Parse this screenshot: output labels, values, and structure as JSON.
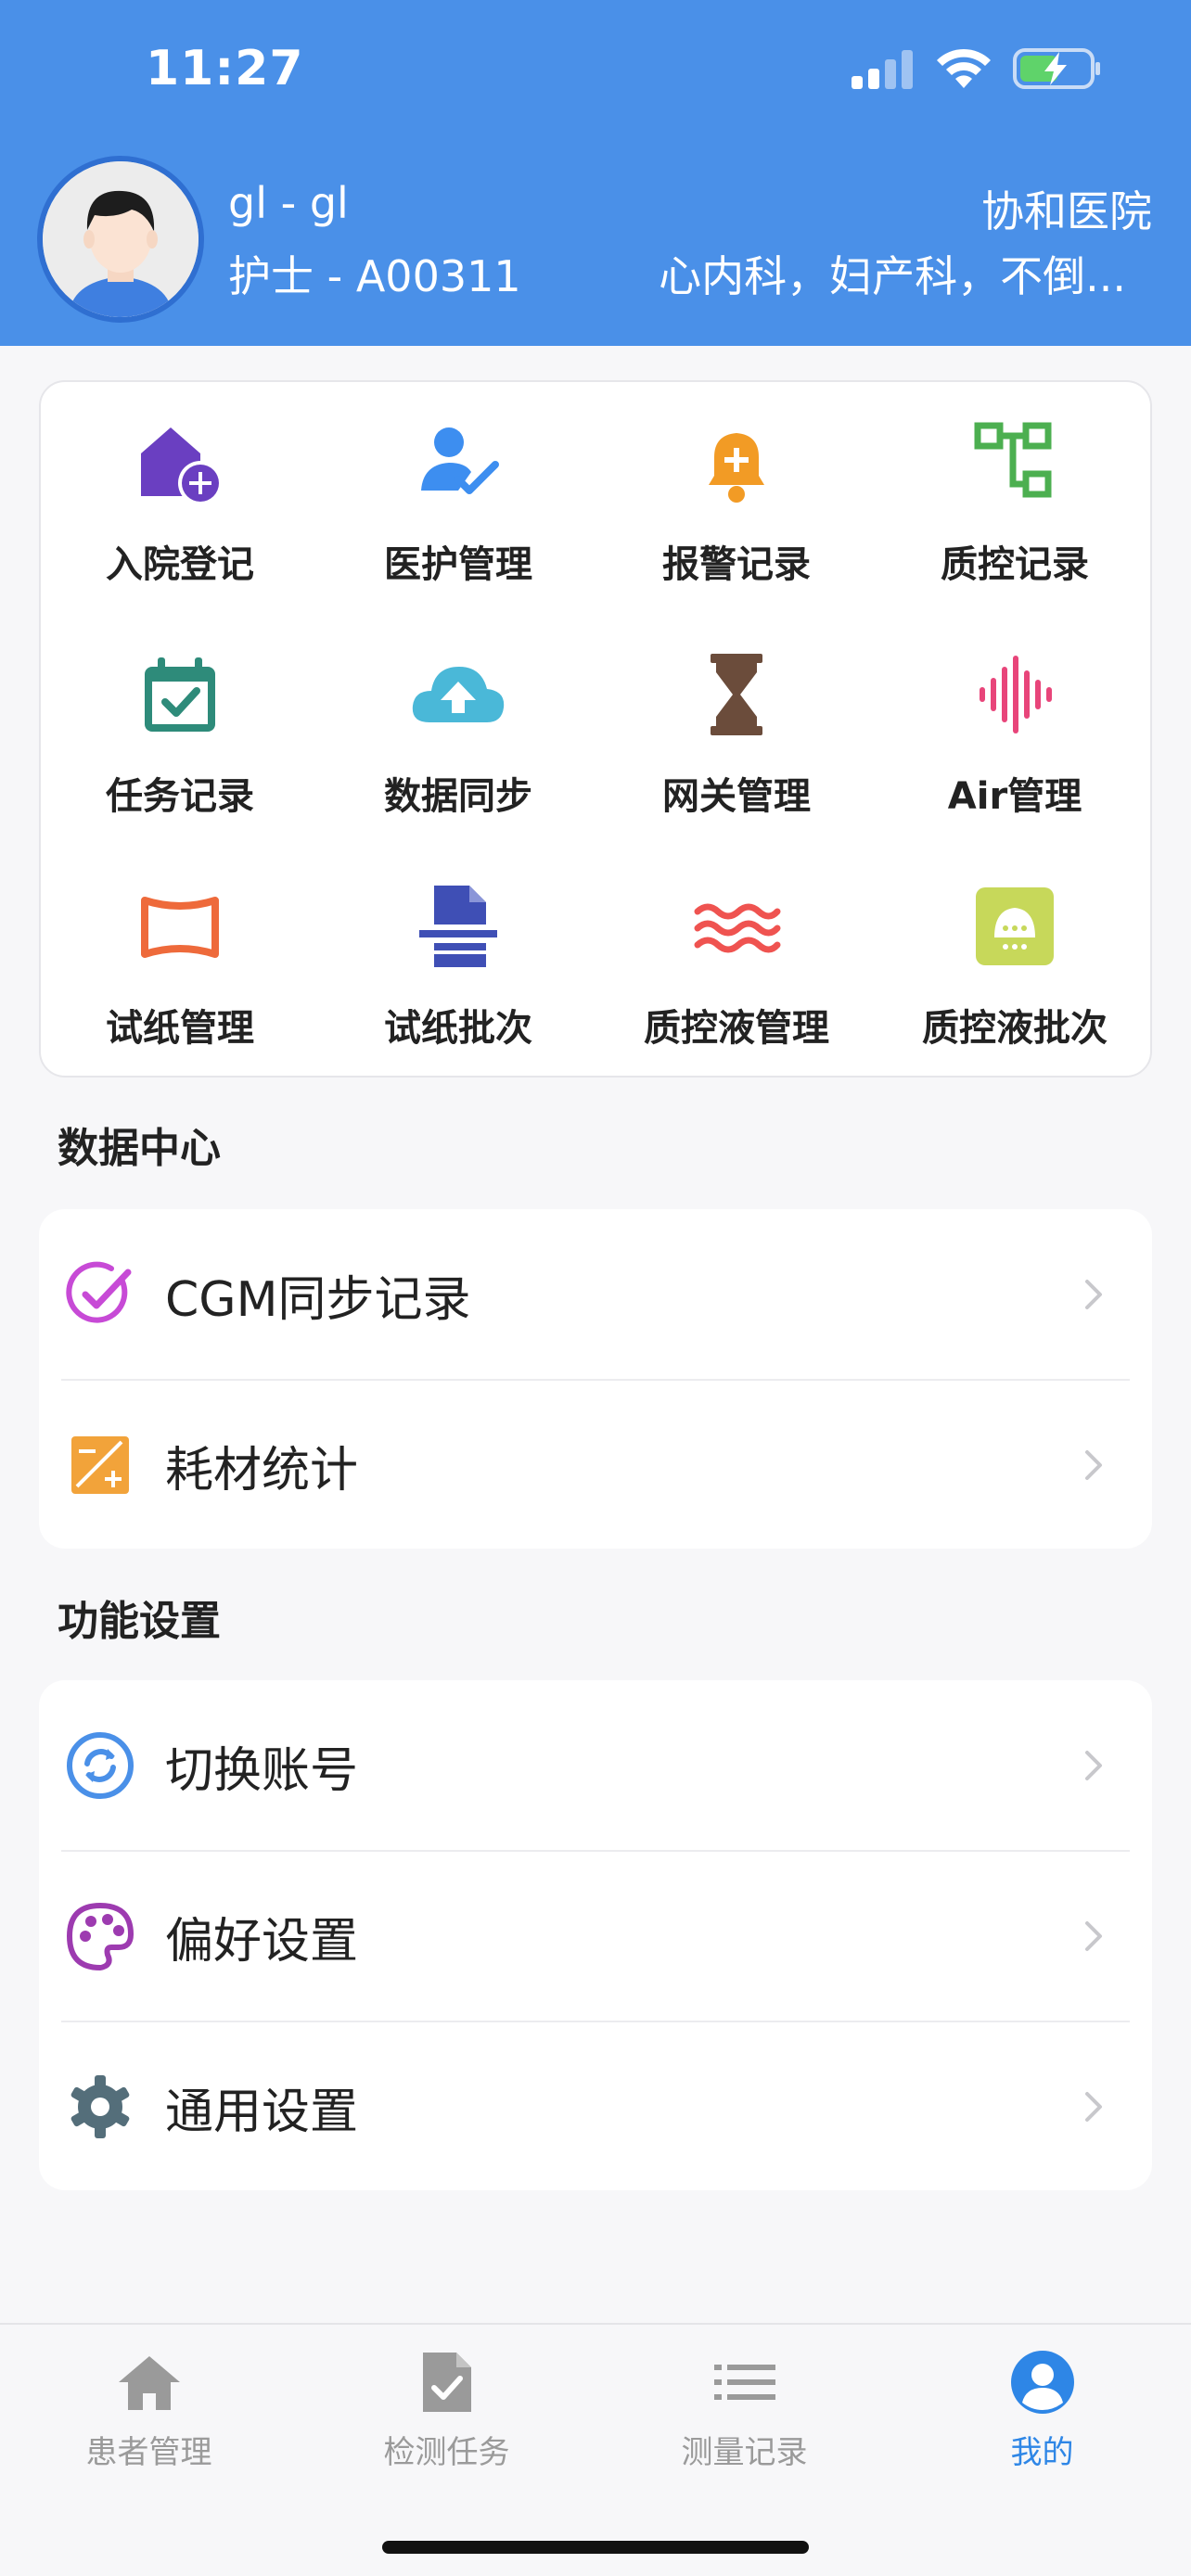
{
  "status_bar": {
    "time": "11:27"
  },
  "profile": {
    "name": "gl - gl",
    "role": "护士 - A00311",
    "hospital": "协和医院",
    "departments": "心内科，妇产科，不倒..."
  },
  "grid": [
    {
      "label": "入院登记",
      "icon": "house-add-icon"
    },
    {
      "label": "医护管理",
      "icon": "user-check-icon"
    },
    {
      "label": "报警记录",
      "icon": "bell-icon"
    },
    {
      "label": "质控记录",
      "icon": "tree-structure-icon"
    },
    {
      "label": "任务记录",
      "icon": "calendar-check-icon"
    },
    {
      "label": "数据同步",
      "icon": "cloud-upload-icon"
    },
    {
      "label": "网关管理",
      "icon": "hourglass-icon"
    },
    {
      "label": "Air管理",
      "icon": "audio-wave-icon"
    },
    {
      "label": "试纸管理",
      "icon": "strip-frame-icon"
    },
    {
      "label": "试纸批次",
      "icon": "document-batch-icon"
    },
    {
      "label": "质控液管理",
      "icon": "waves-icon"
    },
    {
      "label": "质控液批次",
      "icon": "liquid-box-icon"
    }
  ],
  "data_center": {
    "title": "数据中心",
    "items": [
      {
        "label": "CGM同步记录",
        "icon": "circle-check-icon"
      },
      {
        "label": "耗材统计",
        "icon": "stats-plus-icon"
      }
    ]
  },
  "settings": {
    "title": "功能设置",
    "items": [
      {
        "label": "切换账号",
        "icon": "sync-icon"
      },
      {
        "label": "偏好设置",
        "icon": "palette-icon"
      },
      {
        "label": "通用设置",
        "icon": "gear-icon"
      }
    ]
  },
  "tabbar": [
    {
      "label": "患者管理",
      "icon": "home-icon",
      "active": false
    },
    {
      "label": "检测任务",
      "icon": "task-file-icon",
      "active": false
    },
    {
      "label": "测量记录",
      "icon": "list-icon",
      "active": false
    },
    {
      "label": "我的",
      "icon": "user-circle-icon",
      "active": true
    }
  ],
  "colors": {
    "header": "#4a90e8",
    "active_tab": "#2e86e6",
    "inactive_tab": "#9a9a9a"
  }
}
